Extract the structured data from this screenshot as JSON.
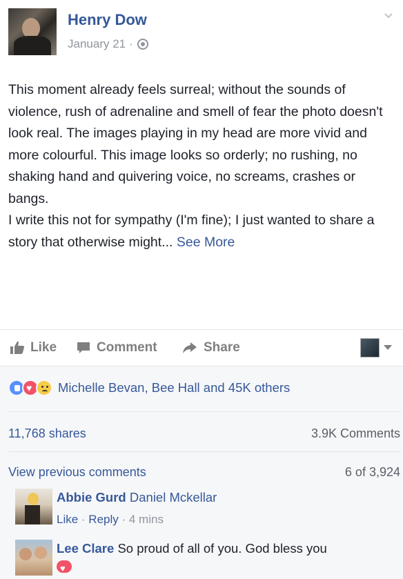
{
  "post": {
    "author": "Henry Dow",
    "date": "January 21 ·",
    "privacy_icon": "globe-icon",
    "menu_icon": "chevron-down-icon",
    "body_lines": [
      "This moment already feels surreal; without the sounds of violence, rush of adrenaline and smell of fear the photo doesn't look real. The images playing in my head are more vivid and more colourful. This image looks so orderly; no rushing, no shaking hand and quivering voice, no screams, crashes or bangs.",
      "I write this not for sympathy (I'm fine); I just wanted to share a story that otherwise might..."
    ],
    "see_more": "See More"
  },
  "actions": {
    "like": "Like",
    "comment": "Comment",
    "share": "Share"
  },
  "reactions": {
    "icons": [
      "like-icon",
      "love-icon",
      "sad-icon"
    ],
    "text": "Michelle Bevan, Bee Hall and 45K others"
  },
  "stats": {
    "shares": "11,768 shares",
    "comments": "3.9K Comments"
  },
  "comments_section": {
    "view_previous": "View previous comments",
    "count": "6 of 3,924",
    "items": [
      {
        "name": "Abbie Gurd",
        "text": "Daniel Mckellar",
        "like": "Like",
        "sep1": " · ",
        "reply": "Reply",
        "sep2": " · ",
        "time": "4 mins"
      },
      {
        "name": "Lee Clare",
        "text": "So proud of all of you. God bless you"
      }
    ]
  },
  "colors": {
    "link_blue": "#365899",
    "meta_gray": "#90949c",
    "panel_bg": "#f6f7f9"
  }
}
